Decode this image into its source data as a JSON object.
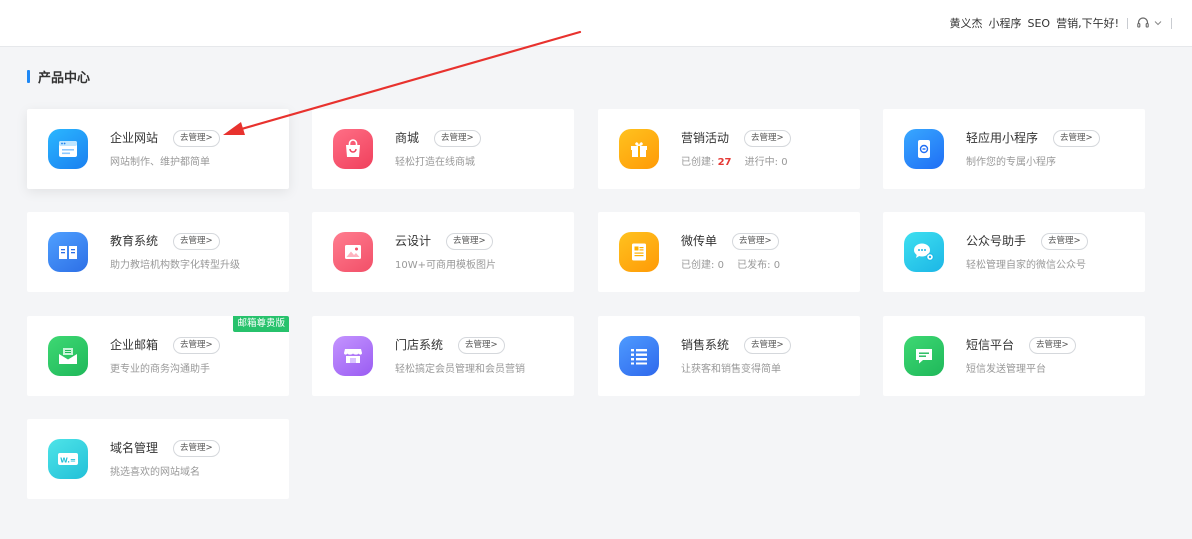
{
  "header": {
    "user_name": "黄义杰",
    "link_miniprogram": "小程序",
    "link_seo": "SEO",
    "greeting": "营销,下午好!",
    "headset_icon": "headset-icon",
    "chevron_icon": "chevron-down-icon"
  },
  "section": {
    "title": "产品中心"
  },
  "colors": {
    "accent": "#1e88f5",
    "ribbon": "#27c26c",
    "count": "#e53935"
  },
  "cards": [
    {
      "name": "企业网站",
      "manage": "去管理>",
      "desc": "网站制作、维护都简单",
      "icon": "browser-window-icon"
    },
    {
      "name": "商城",
      "manage": "去管理>",
      "desc": "轻松打造在线商城",
      "icon": "shopping-bag-icon"
    },
    {
      "name": "营销活动",
      "manage": "去管理>",
      "desc_a": "已创建:",
      "desc_num": "27",
      "desc_b": "进行中:",
      "desc_b_num": "0",
      "icon": "gift-icon"
    },
    {
      "name": "轻应用小程序",
      "manage": "去管理>",
      "desc": "制作您的专属小程序",
      "icon": "mini-program-icon"
    },
    {
      "name": "教育系统",
      "manage": "去管理>",
      "desc": "助力教培机构数字化转型升级",
      "icon": "book-icon"
    },
    {
      "name": "云设计",
      "manage": "去管理>",
      "desc": "10W+可商用模板图片",
      "icon": "image-icon"
    },
    {
      "name": "微传单",
      "manage": "去管理>",
      "desc_a": "已创建:",
      "desc_num": "0",
      "desc_b": "已发布:",
      "desc_b_num": "0",
      "icon": "flyer-icon"
    },
    {
      "name": "公众号助手",
      "manage": "去管理>",
      "desc": "轻松管理自家的微信公众号",
      "icon": "wechat-icon"
    },
    {
      "name": "企业邮箱",
      "manage": "去管理>",
      "desc": "更专业的商务沟通助手",
      "ribbon": "邮箱尊贵版",
      "icon": "envelope-icon"
    },
    {
      "name": "门店系统",
      "manage": "去管理>",
      "desc": "轻松搞定会员管理和会员营销",
      "icon": "storefront-icon"
    },
    {
      "name": "销售系统",
      "manage": "去管理>",
      "desc": "让获客和销售变得简单",
      "icon": "list-icon"
    },
    {
      "name": "短信平台",
      "manage": "去管理>",
      "desc": "短信发送管理平台",
      "icon": "message-icon"
    },
    {
      "name": "域名管理",
      "manage": "去管理>",
      "desc": "挑选喜欢的网站域名",
      "icon": "domain-icon"
    }
  ]
}
